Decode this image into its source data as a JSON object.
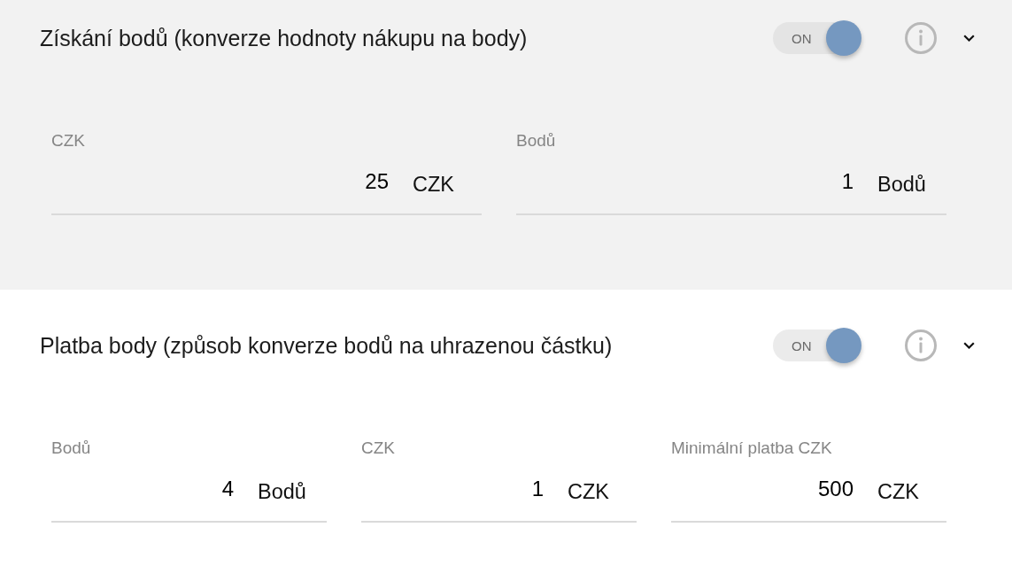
{
  "sections": [
    {
      "title": "Získání bodů (konverze hodnoty nákupu na body)",
      "toggle": {
        "label": "ON",
        "on": true
      },
      "fields": [
        {
          "label": "CZK",
          "value": "25",
          "unit": "CZK"
        },
        {
          "label": "Bodů",
          "value": "1",
          "unit": "Bodů"
        }
      ]
    },
    {
      "title": "Platba body (způsob konverze bodů na uhrazenou částku)",
      "toggle": {
        "label": "ON",
        "on": true
      },
      "fields": [
        {
          "label": "Bodů",
          "value": "4",
          "unit": "Bodů"
        },
        {
          "label": "CZK",
          "value": "1",
          "unit": "CZK"
        },
        {
          "label": "Minimální platba CZK",
          "value": "500",
          "unit": "CZK"
        }
      ]
    }
  ]
}
